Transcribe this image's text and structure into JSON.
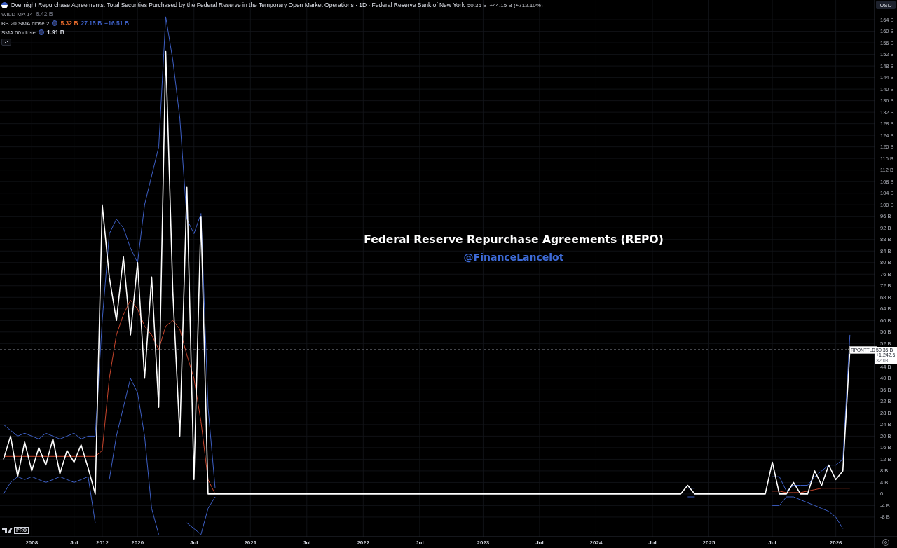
{
  "legend": {
    "title": "Overnight Repurchase Agreements: Total Securities Purchased by the Federal Reserve in the Temporary Open Market Operations · 1D · Federal Reserve Bank of New York",
    "last": "50.35 B",
    "change": "+44.15 B (+712.10%)"
  },
  "indicators": [
    {
      "name": "WILD MA 14",
      "hidden": true,
      "values": [
        {
          "text": "6.42 B",
          "color": "#5d606b"
        }
      ]
    },
    {
      "name": "BB 20 SMA close 2",
      "hidden": false,
      "values": [
        {
          "text": "5.32 B",
          "color": "#e3692b"
        },
        {
          "text": "27.15 B",
          "color": "#3d5fc4"
        },
        {
          "text": "−16.51 B",
          "color": "#3d5fc4"
        }
      ]
    },
    {
      "name": "SMA 60 close",
      "hidden": false,
      "values": [
        {
          "text": "1.91 B",
          "color": "#d1d4dc"
        }
      ]
    }
  ],
  "currency_button": "USD",
  "annotation": {
    "title": "Federal Reserve Repurchase Agreements (REPO)",
    "handle": "@FinanceLancelot"
  },
  "price_label": {
    "value": "50.35 B",
    "change": "+1,242.6",
    "countdown": "32:03"
  },
  "logo_badge": "PRO",
  "chart": {
    "chart_data": {
      "type": "line",
      "categories": [
        null,
        null,
        null,
        null,
        "2008",
        null,
        null,
        null,
        null,
        null,
        "Jul",
        null,
        null,
        null,
        "2012",
        null,
        null,
        null,
        null,
        "2020",
        null,
        null,
        null,
        null,
        null,
        null,
        null,
        "Jul",
        null,
        null,
        null,
        null,
        null,
        null,
        null,
        "2021",
        null,
        null,
        null,
        null,
        null,
        null,
        null,
        "Jul",
        null,
        null,
        null,
        null,
        null,
        null,
        null,
        "2022",
        null,
        null,
        null,
        null,
        null,
        null,
        null,
        "Jul",
        null,
        null,
        null,
        null,
        null,
        null,
        null,
        null,
        "2023",
        null,
        null,
        null,
        null,
        null,
        null,
        null,
        "Jul",
        null,
        null,
        null,
        null,
        null,
        null,
        null,
        "2024",
        null,
        null,
        null,
        null,
        null,
        null,
        null,
        "Jul",
        null,
        null,
        null,
        null,
        null,
        null,
        null,
        "2025",
        null,
        null,
        null,
        null,
        null,
        null,
        null,
        null,
        "Jul",
        null,
        null,
        null,
        null,
        null,
        null,
        null,
        null,
        "2026",
        null,
        null,
        null,
        null,
        null
      ],
      "series": [
        {
          "name": "RPONTTLD",
          "color": "#ffffff",
          "values": [
            12,
            20,
            6,
            18,
            8,
            16,
            10,
            19,
            7,
            15,
            11,
            17,
            9,
            0,
            100,
            75,
            60,
            82,
            55,
            80,
            40,
            75,
            30,
            153,
            70,
            20,
            106,
            5,
            96,
            0,
            0,
            0,
            0,
            0,
            0,
            0,
            0,
            0,
            0,
            0,
            0,
            0,
            0,
            0,
            0,
            0,
            0,
            0,
            0,
            0,
            0,
            0,
            0,
            0,
            0,
            0,
            0,
            0,
            0,
            0,
            0,
            0,
            0,
            0,
            0,
            0,
            0,
            0,
            0,
            0,
            0,
            0,
            0,
            0,
            0,
            0,
            0,
            0,
            0,
            0,
            0,
            0,
            0,
            0,
            0,
            0,
            0,
            0,
            0,
            0,
            0,
            0,
            0,
            0,
            0,
            0,
            0,
            3,
            0,
            0,
            0,
            0,
            0,
            0,
            0,
            0,
            0,
            0,
            0,
            11,
            0,
            0,
            4,
            0,
            0,
            8,
            3,
            10,
            5,
            8,
            50,
            null,
            null,
            null
          ]
        },
        {
          "color": "#c8452c",
          "values": [
            13,
            13,
            13,
            13,
            13,
            13,
            13,
            13,
            13,
            13,
            13,
            13,
            13,
            13,
            15,
            40,
            55,
            62,
            67,
            64,
            58,
            55,
            50,
            58,
            60,
            57,
            48,
            40,
            25,
            5,
            0,
            null,
            null,
            null,
            null,
            null,
            null,
            null,
            null,
            null,
            null,
            null,
            null,
            null,
            null,
            null,
            null,
            null,
            null,
            null,
            null,
            null,
            null,
            null,
            null,
            null,
            null,
            null,
            null,
            null,
            null,
            null,
            null,
            null,
            null,
            null,
            null,
            null,
            null,
            null,
            null,
            null,
            null,
            null,
            null,
            null,
            null,
            null,
            null,
            null,
            null,
            null,
            null,
            null,
            null,
            null,
            null,
            null,
            null,
            null,
            null,
            null,
            null,
            null,
            null,
            null,
            null,
            null,
            null,
            null,
            null,
            null,
            null,
            null,
            null,
            null,
            null,
            null,
            null,
            1,
            1,
            0.5,
            0.5,
            0.5,
            1,
            1.5,
            2,
            2,
            2,
            2,
            2,
            null,
            null,
            null
          ]
        },
        {
          "color": "#3d5fc4",
          "values": [
            24,
            22,
            20,
            21,
            20,
            19,
            21,
            20,
            19,
            20,
            21,
            19,
            20,
            20,
            60,
            90,
            95,
            92,
            85,
            80,
            100,
            110,
            120,
            165,
            150,
            130,
            95,
            90,
            97,
            30,
            2,
            null,
            null,
            null,
            null,
            null,
            null,
            null,
            null,
            null,
            null,
            null,
            null,
            null,
            null,
            null,
            null,
            null,
            null,
            null,
            null,
            null,
            null,
            null,
            null,
            null,
            null,
            null,
            null,
            null,
            null,
            null,
            null,
            null,
            null,
            null,
            null,
            null,
            null,
            null,
            null,
            null,
            null,
            null,
            null,
            null,
            null,
            null,
            null,
            null,
            null,
            null,
            null,
            null,
            null,
            null,
            null,
            null,
            null,
            null,
            null,
            null,
            null,
            null,
            null,
            null,
            null,
            2,
            2,
            null,
            null,
            null,
            null,
            null,
            null,
            null,
            null,
            null,
            null,
            6,
            6,
            1,
            3,
            3,
            3,
            6,
            8,
            10,
            10,
            12,
            55,
            null,
            null,
            null
          ]
        },
        {
          "color": "#3d5fc4",
          "values": [
            0,
            4,
            6,
            5,
            6,
            5,
            4,
            5,
            6,
            5,
            4,
            5,
            6,
            -10,
            null,
            5,
            20,
            30,
            40,
            35,
            20,
            -5,
            -14,
            null,
            null,
            null,
            -10,
            -12,
            -14,
            -5,
            -1,
            null,
            null,
            null,
            null,
            null,
            null,
            null,
            null,
            null,
            null,
            null,
            null,
            null,
            null,
            null,
            null,
            null,
            null,
            null,
            null,
            null,
            null,
            null,
            null,
            null,
            null,
            null,
            null,
            null,
            null,
            null,
            null,
            null,
            null,
            null,
            null,
            null,
            null,
            null,
            null,
            null,
            null,
            null,
            null,
            null,
            null,
            null,
            null,
            null,
            null,
            null,
            null,
            null,
            null,
            null,
            null,
            null,
            null,
            null,
            null,
            null,
            null,
            null,
            null,
            null,
            null,
            -1,
            -1,
            null,
            null,
            null,
            null,
            null,
            null,
            null,
            null,
            null,
            null,
            -4,
            -4,
            -1,
            -1,
            -2,
            -3,
            -4,
            -5,
            -6,
            -8,
            -12,
            null,
            null,
            null,
            null
          ]
        }
      ],
      "grid": true,
      "ylim": [
        -14.8,
        170.8
      ],
      "yticks": [
        {
          "value": -8,
          "label": "-8 B"
        },
        {
          "value": -4,
          "label": "-4 B"
        },
        {
          "value": 0,
          "label": "0"
        },
        {
          "value": 4,
          "label": "4 B"
        },
        {
          "value": 8,
          "label": "8 B"
        },
        {
          "value": 12,
          "label": "12 B"
        },
        {
          "value": 16,
          "label": "16 B"
        },
        {
          "value": 20,
          "label": "20 B"
        },
        {
          "value": 24,
          "label": "24 B"
        },
        {
          "value": 28,
          "label": "28 B"
        },
        {
          "value": 32,
          "label": "32 B"
        },
        {
          "value": 36,
          "label": "36 B"
        },
        {
          "value": 40,
          "label": "40 B"
        },
        {
          "value": 44,
          "label": "44 B"
        },
        {
          "value": 52,
          "label": "52 B"
        },
        {
          "value": 56,
          "label": "56 B"
        },
        {
          "value": 60,
          "label": "60 B"
        },
        {
          "value": 64,
          "label": "64 B"
        },
        {
          "value": 68,
          "label": "68 B"
        },
        {
          "value": 72,
          "label": "72 B"
        },
        {
          "value": 76,
          "label": "76 B"
        },
        {
          "value": 80,
          "label": "80 B"
        },
        {
          "value": 84,
          "label": "84 B"
        },
        {
          "value": 88,
          "label": "88 B"
        },
        {
          "value": 92,
          "label": "92 B"
        },
        {
          "value": 96,
          "label": "96 B"
        },
        {
          "value": 100,
          "label": "100 B"
        },
        {
          "value": 104,
          "label": "104 B"
        },
        {
          "value": 108,
          "label": "108 B"
        },
        {
          "value": 112,
          "label": "112 B"
        },
        {
          "value": 116,
          "label": "116 B"
        },
        {
          "value": 120,
          "label": "120 B"
        },
        {
          "value": 124,
          "label": "124 B"
        },
        {
          "value": 128,
          "label": "128 B"
        },
        {
          "value": 132,
          "label": "132 B"
        },
        {
          "value": 136,
          "label": "136 B"
        },
        {
          "value": 140,
          "label": "140 B"
        },
        {
          "value": 144,
          "label": "144 B"
        },
        {
          "value": 148,
          "label": "148 B"
        },
        {
          "value": 152,
          "label": "152 B"
        },
        {
          "value": 156,
          "label": "156 B"
        },
        {
          "value": 160,
          "label": "160 B"
        },
        {
          "value": 164,
          "label": "164 B"
        }
      ]
    }
  }
}
